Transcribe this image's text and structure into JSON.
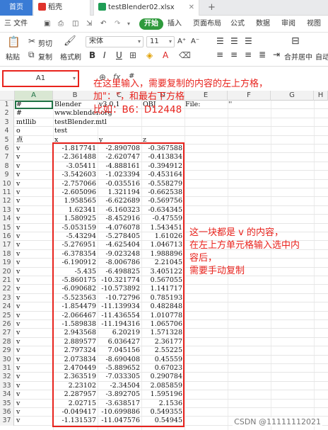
{
  "tabs": {
    "home": "首页",
    "draft": "稻壳",
    "file": "testBlender02.xlsx"
  },
  "menu": {
    "file": "三 文件",
    "start": "开始",
    "items": [
      "插入",
      "页面布局",
      "公式",
      "数据",
      "审阅",
      "视图"
    ]
  },
  "ribbon": {
    "paste": "粘贴",
    "cut": "剪切",
    "copy": "复制",
    "format_painter": "格式刷",
    "font_name": "宋体",
    "font_size": "11",
    "merge_center": "合并居中",
    "auto": "自动"
  },
  "namebox": {
    "value": "A1"
  },
  "formula": {
    "fx": "fx",
    "content": "#"
  },
  "columns": [
    "A",
    "B",
    "C",
    "D",
    "E",
    "F",
    "G",
    "H"
  ],
  "rows": [
    {
      "n": "1",
      "a": "#",
      "b": "Blender",
      "c": "v3.0.1",
      "d": "OBJ",
      "e": "File:",
      "f": "''"
    },
    {
      "n": "2",
      "a": "#",
      "b": "www.blender.org",
      "c": "",
      "d": ""
    },
    {
      "n": "3",
      "a": "mtllib",
      "b": "testBlender.mtl",
      "c": "",
      "d": ""
    },
    {
      "n": "4",
      "a": "o",
      "b": "test",
      "c": "",
      "d": ""
    },
    {
      "n": "5",
      "a": "点",
      "b": "x",
      "c": "y",
      "d": "z"
    },
    {
      "n": "6",
      "a": "v",
      "b": "-1.817741",
      "c": "-2.890708",
      "d": "-0.367588"
    },
    {
      "n": "7",
      "a": "v",
      "b": "-2.361488",
      "c": "-2.620747",
      "d": "-0.413834"
    },
    {
      "n": "8",
      "a": "v",
      "b": "-3.05411",
      "c": "-4.888161",
      "d": "-0.394912"
    },
    {
      "n": "9",
      "a": "v",
      "b": "-3.542603",
      "c": "-1.023394",
      "d": "-0.453164"
    },
    {
      "n": "10",
      "a": "v",
      "b": "-2.757066",
      "c": "-0.035516",
      "d": "-0.558279"
    },
    {
      "n": "11",
      "a": "v",
      "b": "-2.605096",
      "c": "1.321194",
      "d": "-0.662538"
    },
    {
      "n": "12",
      "a": "v",
      "b": "1.958565",
      "c": "-6.622689",
      "d": "-0.569756"
    },
    {
      "n": "13",
      "a": "v",
      "b": "1.62341",
      "c": "-6.160323",
      "d": "-0.634345"
    },
    {
      "n": "14",
      "a": "v",
      "b": "1.580925",
      "c": "-8.452916",
      "d": "-0.47559"
    },
    {
      "n": "15",
      "a": "v",
      "b": "-5.053159",
      "c": "-4.076078",
      "d": "1.543451"
    },
    {
      "n": "16",
      "a": "v",
      "b": "-5.43294",
      "c": "-5.278405",
      "d": "1.61026"
    },
    {
      "n": "17",
      "a": "v",
      "b": "-5.276951",
      "c": "-4.625404",
      "d": "1.046713"
    },
    {
      "n": "18",
      "a": "v",
      "b": "-6.378354",
      "c": "-9.023248",
      "d": "1.988896"
    },
    {
      "n": "19",
      "a": "v",
      "b": "-6.190912",
      "c": "-8.006786",
      "d": "2.21045"
    },
    {
      "n": "20",
      "a": "v",
      "b": "-5.435",
      "c": "-6.498825",
      "d": "3.405122"
    },
    {
      "n": "21",
      "a": "v",
      "b": "-5.860175",
      "c": "-10.321774",
      "d": "0.567055"
    },
    {
      "n": "22",
      "a": "v",
      "b": "-6.090682",
      "c": "-10.573892",
      "d": "1.141717"
    },
    {
      "n": "23",
      "a": "v",
      "b": "-5.523563",
      "c": "-10.72796",
      "d": "0.785193"
    },
    {
      "n": "24",
      "a": "v",
      "b": "-1.854479",
      "c": "-11.139934",
      "d": "0.482848"
    },
    {
      "n": "25",
      "a": "v",
      "b": "-2.066467",
      "c": "-11.436554",
      "d": "1.010778"
    },
    {
      "n": "26",
      "a": "v",
      "b": "-1.589838",
      "c": "-11.194316",
      "d": "1.065706"
    },
    {
      "n": "27",
      "a": "v",
      "b": "2.943568",
      "c": "6.20219",
      "d": "1.571328"
    },
    {
      "n": "28",
      "a": "v",
      "b": "2.889577",
      "c": "6.036427",
      "d": "2.36177"
    },
    {
      "n": "29",
      "a": "v",
      "b": "2.797324",
      "c": "7.045156",
      "d": "2.55225"
    },
    {
      "n": "30",
      "a": "v",
      "b": "2.073834",
      "c": "-8.690408",
      "d": "0.45559"
    },
    {
      "n": "31",
      "a": "v",
      "b": "2.470449",
      "c": "-5.889652",
      "d": "0.67023"
    },
    {
      "n": "32",
      "a": "v",
      "b": "2.363519",
      "c": "-7.033305",
      "d": "0.290784"
    },
    {
      "n": "33",
      "a": "v",
      "b": "2.23102",
      "c": "-2.34504",
      "d": "2.085859"
    },
    {
      "n": "34",
      "a": "v",
      "b": "2.287957",
      "c": "-3.892705",
      "d": "1.595196"
    },
    {
      "n": "35",
      "a": "v",
      "b": "2.02715",
      "c": "-3.638517",
      "d": "2.1536"
    },
    {
      "n": "36",
      "a": "v",
      "b": "-0.049417",
      "c": "-10.699886",
      "d": "0.549355"
    },
    {
      "n": "37",
      "a": "v",
      "b": "-1.131537",
      "c": "-11.047576",
      "d": "0.54945"
    }
  ],
  "annotations": {
    "top_line1": "在这里输入，需要复制的内容的左上方格，",
    "top_line2": "加\"：\"，和最右下方格",
    "top_line3": "比如：B6：D12448",
    "side_line1": "这一块都是 v 的内容，",
    "side_line2": "在左上方单元格输入选中内",
    "side_line3": "容后，",
    "side_line4": "需要手动复制"
  },
  "watermark": "CSDN @11111112021",
  "colors": {
    "annotation_red": "#e8231d",
    "tab_blue": "#3a7bd5",
    "start_green": "#2f9a3c",
    "selection_green": "#217346"
  }
}
